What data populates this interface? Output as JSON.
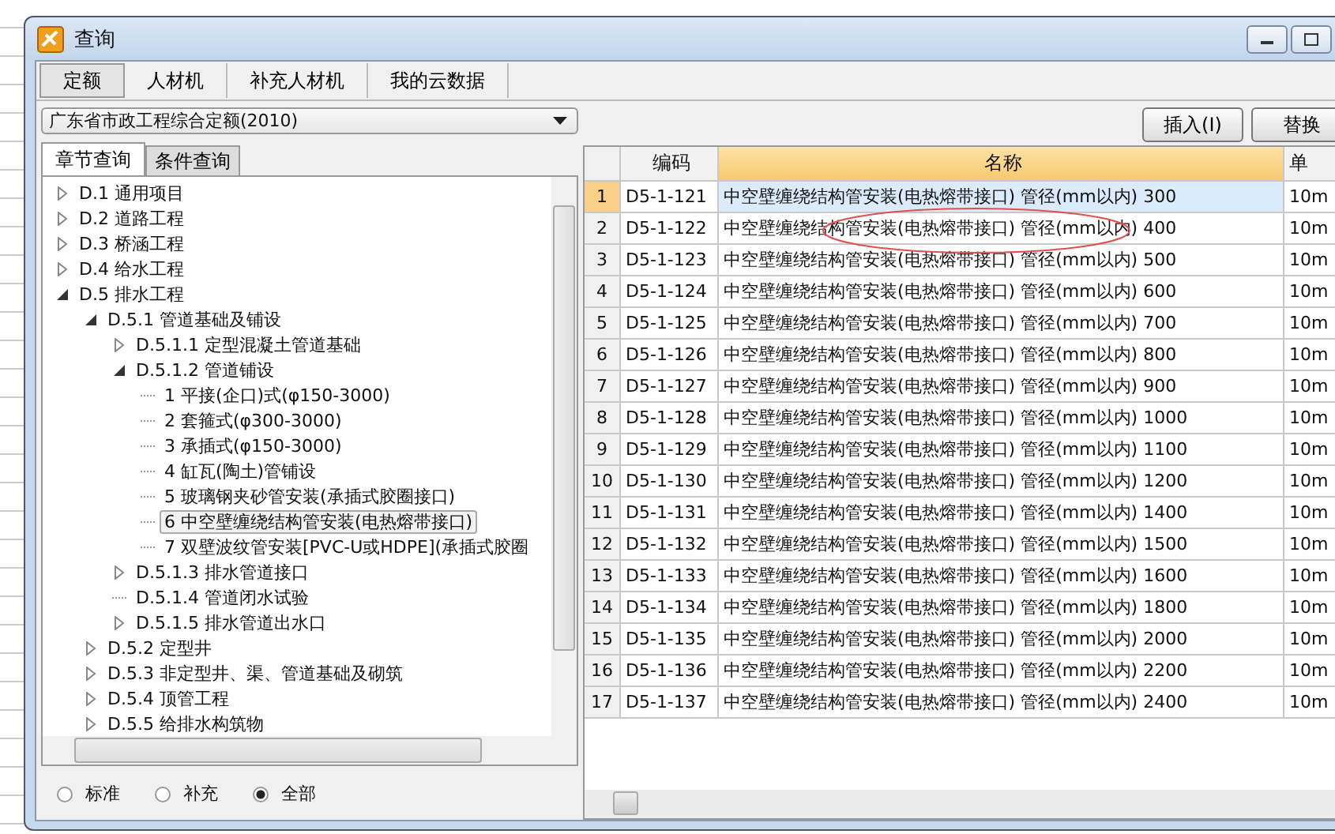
{
  "window": {
    "title": "查询"
  },
  "tabs": [
    {
      "label": "定额",
      "selected": true
    },
    {
      "label": "人材机",
      "selected": false
    },
    {
      "label": "补充人材机",
      "selected": false
    },
    {
      "label": "我的云数据",
      "selected": false
    }
  ],
  "library_select": {
    "value": "广东省市政工程综合定额(2010)"
  },
  "subtabs": [
    {
      "label": "章节查询",
      "selected": true
    },
    {
      "label": "条件查询",
      "selected": false
    }
  ],
  "tree": [
    {
      "label": "D.1 通用项目",
      "kind": "branch",
      "expanded": false,
      "selected": false
    },
    {
      "label": "D.2 道路工程",
      "kind": "branch",
      "expanded": false,
      "selected": false
    },
    {
      "label": "D.3 桥涵工程",
      "kind": "branch",
      "expanded": false,
      "selected": false
    },
    {
      "label": "D.4 给水工程",
      "kind": "branch",
      "expanded": false,
      "selected": false
    },
    {
      "label": "D.5 排水工程",
      "kind": "branch",
      "expanded": true,
      "selected": false,
      "children": [
        {
          "label": "D.5.1 管道基础及铺设",
          "kind": "branch",
          "expanded": true,
          "selected": false,
          "children": [
            {
              "label": "D.5.1.1 定型混凝土管道基础",
              "kind": "branch",
              "expanded": false,
              "selected": false
            },
            {
              "label": "D.5.1.2 管道铺设",
              "kind": "branch",
              "expanded": true,
              "selected": false,
              "children": [
                {
                  "label": "1 平接(企口)式(φ150-3000)",
                  "kind": "leaf",
                  "selected": false
                },
                {
                  "label": "2 套箍式(φ300-3000)",
                  "kind": "leaf",
                  "selected": false
                },
                {
                  "label": "3 承插式(φ150-3000)",
                  "kind": "leaf",
                  "selected": false
                },
                {
                  "label": "4 缸瓦(陶土)管铺设",
                  "kind": "leaf",
                  "selected": false
                },
                {
                  "label": "5 玻璃钢夹砂管安装(承插式胶圈接口)",
                  "kind": "leaf",
                  "selected": false
                },
                {
                  "label": "6 中空壁缠绕结构管安装(电热熔带接口)",
                  "kind": "leaf",
                  "selected": true
                },
                {
                  "label": "7 双壁波纹管安装[PVC-U或HDPE](承插式胶圈",
                  "kind": "leaf",
                  "selected": false
                }
              ]
            },
            {
              "label": "D.5.1.3 排水管道接口",
              "kind": "branch",
              "expanded": false,
              "selected": false
            },
            {
              "label": "D.5.1.4 管道闭水试验",
              "kind": "leaf",
              "selected": false
            },
            {
              "label": "D.5.1.5 排水管道出水口",
              "kind": "branch",
              "expanded": false,
              "selected": false
            }
          ]
        },
        {
          "label": "D.5.2 定型井",
          "kind": "branch",
          "expanded": false,
          "selected": false
        },
        {
          "label": "D.5.3 非定型井、渠、管道基础及砌筑",
          "kind": "branch",
          "expanded": false,
          "selected": false
        },
        {
          "label": "D.5.4 顶管工程",
          "kind": "branch",
          "expanded": false,
          "selected": false
        },
        {
          "label": "D.5.5 给排水构筑物",
          "kind": "branch",
          "expanded": false,
          "selected": false
        }
      ]
    }
  ],
  "filter_options": [
    {
      "label": "标准",
      "selected": false
    },
    {
      "label": "补充",
      "selected": false
    },
    {
      "label": "全部",
      "selected": true
    }
  ],
  "toolbar_buttons": [
    "插入(I)",
    "替换"
  ],
  "table": {
    "columns": [
      {
        "label": "编码",
        "selected": false
      },
      {
        "label": "名称",
        "selected": true
      },
      {
        "label": "单",
        "selected": false
      }
    ],
    "rows": [
      {
        "num": "1",
        "code": "D5-1-121",
        "name": "中空壁缠绕结构管安装(电热熔带接口) 管径(mm以内) 300",
        "unit": "10m",
        "selected": true
      },
      {
        "num": "2",
        "code": "D5-1-122",
        "name": "中空壁缠绕结构管安装(电热熔带接口) 管径(mm以内) 400",
        "unit": "10m",
        "selected": false
      },
      {
        "num": "3",
        "code": "D5-1-123",
        "name": "中空壁缠绕结构管安装(电热熔带接口) 管径(mm以内) 500",
        "unit": "10m",
        "selected": false
      },
      {
        "num": "4",
        "code": "D5-1-124",
        "name": "中空壁缠绕结构管安装(电热熔带接口) 管径(mm以内) 600",
        "unit": "10m",
        "selected": false
      },
      {
        "num": "5",
        "code": "D5-1-125",
        "name": "中空壁缠绕结构管安装(电热熔带接口) 管径(mm以内) 700",
        "unit": "10m",
        "selected": false
      },
      {
        "num": "6",
        "code": "D5-1-126",
        "name": "中空壁缠绕结构管安装(电热熔带接口) 管径(mm以内) 800",
        "unit": "10m",
        "selected": false
      },
      {
        "num": "7",
        "code": "D5-1-127",
        "name": "中空壁缠绕结构管安装(电热熔带接口) 管径(mm以内) 900",
        "unit": "10m",
        "selected": false
      },
      {
        "num": "8",
        "code": "D5-1-128",
        "name": "中空壁缠绕结构管安装(电热熔带接口) 管径(mm以内) 1000",
        "unit": "10m",
        "selected": false
      },
      {
        "num": "9",
        "code": "D5-1-129",
        "name": "中空壁缠绕结构管安装(电热熔带接口) 管径(mm以内) 1100",
        "unit": "10m",
        "selected": false
      },
      {
        "num": "10",
        "code": "D5-1-130",
        "name": "中空壁缠绕结构管安装(电热熔带接口) 管径(mm以内) 1200",
        "unit": "10m",
        "selected": false
      },
      {
        "num": "11",
        "code": "D5-1-131",
        "name": "中空壁缠绕结构管安装(电热熔带接口) 管径(mm以内) 1400",
        "unit": "10m",
        "selected": false
      },
      {
        "num": "12",
        "code": "D5-1-132",
        "name": "中空壁缠绕结构管安装(电热熔带接口) 管径(mm以内) 1500",
        "unit": "10m",
        "selected": false
      },
      {
        "num": "13",
        "code": "D5-1-133",
        "name": "中空壁缠绕结构管安装(电热熔带接口) 管径(mm以内) 1600",
        "unit": "10m",
        "selected": false
      },
      {
        "num": "14",
        "code": "D5-1-134",
        "name": "中空壁缠绕结构管安装(电热熔带接口) 管径(mm以内) 1800",
        "unit": "10m",
        "selected": false
      },
      {
        "num": "15",
        "code": "D5-1-135",
        "name": "中空壁缠绕结构管安装(电热熔带接口) 管径(mm以内) 2000",
        "unit": "10m",
        "selected": false
      },
      {
        "num": "16",
        "code": "D5-1-136",
        "name": "中空壁缠绕结构管安装(电热熔带接口) 管径(mm以内) 2200",
        "unit": "10m",
        "selected": false
      },
      {
        "num": "17",
        "code": "D5-1-137",
        "name": "中空壁缠绕结构管安装(电热熔带接口) 管径(mm以内) 2400",
        "unit": "10m",
        "selected": false
      }
    ]
  }
}
